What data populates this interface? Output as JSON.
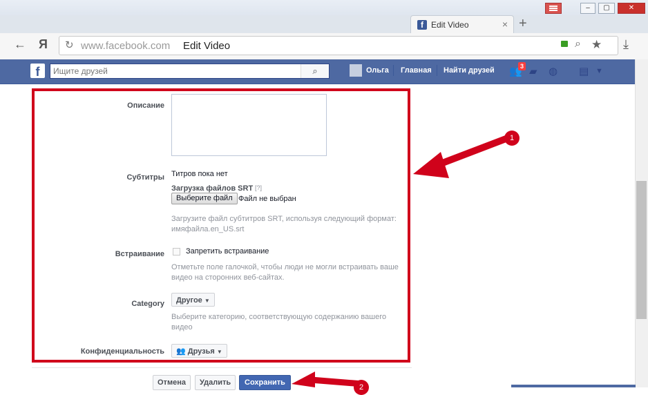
{
  "browser": {
    "tab_title": "Edit Video",
    "tab_close": "×",
    "new_tab": "+",
    "yandex_label": "Я",
    "url_domain": "www.facebook.com",
    "url_title": "Edit Video"
  },
  "fb_header": {
    "logo": "f",
    "search_placeholder": "Ищите друзей",
    "user_name": "Ольга",
    "home_label": "Главная",
    "find_friends_label": "Найти друзей",
    "friend_requests_count": "3",
    "brand_color": "#4e69a2"
  },
  "form": {
    "description_label": "Описание",
    "subtitles_label": "Субтитры",
    "subtitles_none": "Титров пока нет",
    "srt_upload_label": "Загрузка файлов SRT",
    "srt_help": "[?]",
    "choose_file_button": "Выберите файл",
    "no_file_chosen": "Файл не выбран",
    "srt_hint": "Загрузите файл субтитров SRT, используя следующий формат: имяфайла.en_US.srt",
    "embedding_label": "Встраивание",
    "embedding_checkbox_label": "Запретить встраивание",
    "embedding_hint": "Отметьте поле галочкой, чтобы люди не могли встраивать ваше видео на сторонних веб-сайтах.",
    "category_label": "Category",
    "category_value": "Другое",
    "category_hint": "Выберите категорию, соответствующую содержанию вашего видео",
    "privacy_label": "Конфиденциальность",
    "privacy_value": "Друзья"
  },
  "actions": {
    "cancel": "Отмена",
    "delete": "Удалить",
    "save": "Сохранить"
  },
  "annotations": {
    "marker_1": "1",
    "marker_2": "2",
    "highlight_color": "#d0021b"
  }
}
